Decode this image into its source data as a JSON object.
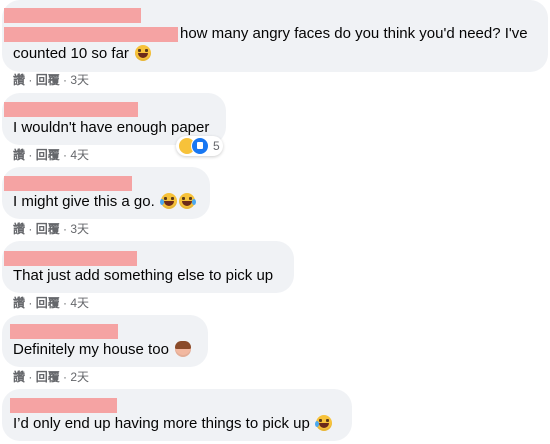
{
  "comments": [
    {
      "text": "how many angry faces do you think you'd need? I've counted 10 so far",
      "line1": "how many angry faces do you think you'd need? I've",
      "line2": "counted 10 so far",
      "emoji": "rofl-emoji",
      "actions": {
        "like": "讚",
        "reply": "回覆",
        "time": "3天"
      }
    },
    {
      "text": "I wouldn't have enough paper",
      "actions": {
        "like": "讚",
        "reply": "回覆",
        "time": "4天"
      },
      "reactions": {
        "icons": [
          "haha-reaction-icon",
          "like-reaction-icon"
        ],
        "count": "5"
      }
    },
    {
      "text": "I might give this a go.",
      "emoji": "joy-emoji x2",
      "actions": {
        "like": "讚",
        "reply": "回覆",
        "time": "3天"
      }
    },
    {
      "text": "That just add something else to pick up",
      "actions": {
        "like": "讚",
        "reply": "回覆",
        "time": "4天"
      }
    },
    {
      "text": "Definitely my house too",
      "emoji": "woman-facepalming-emoji",
      "actions": {
        "like": "讚",
        "reply": "回覆",
        "time": "2天"
      }
    },
    {
      "text": "I’d only end up having more things to pick up",
      "emoji": "joy-emoji"
    }
  ],
  "colors": {
    "bubble": "#f0f2f5",
    "meta": "#65676b",
    "redaction": "#f5a3a3",
    "like_blue": "#1877f2"
  }
}
